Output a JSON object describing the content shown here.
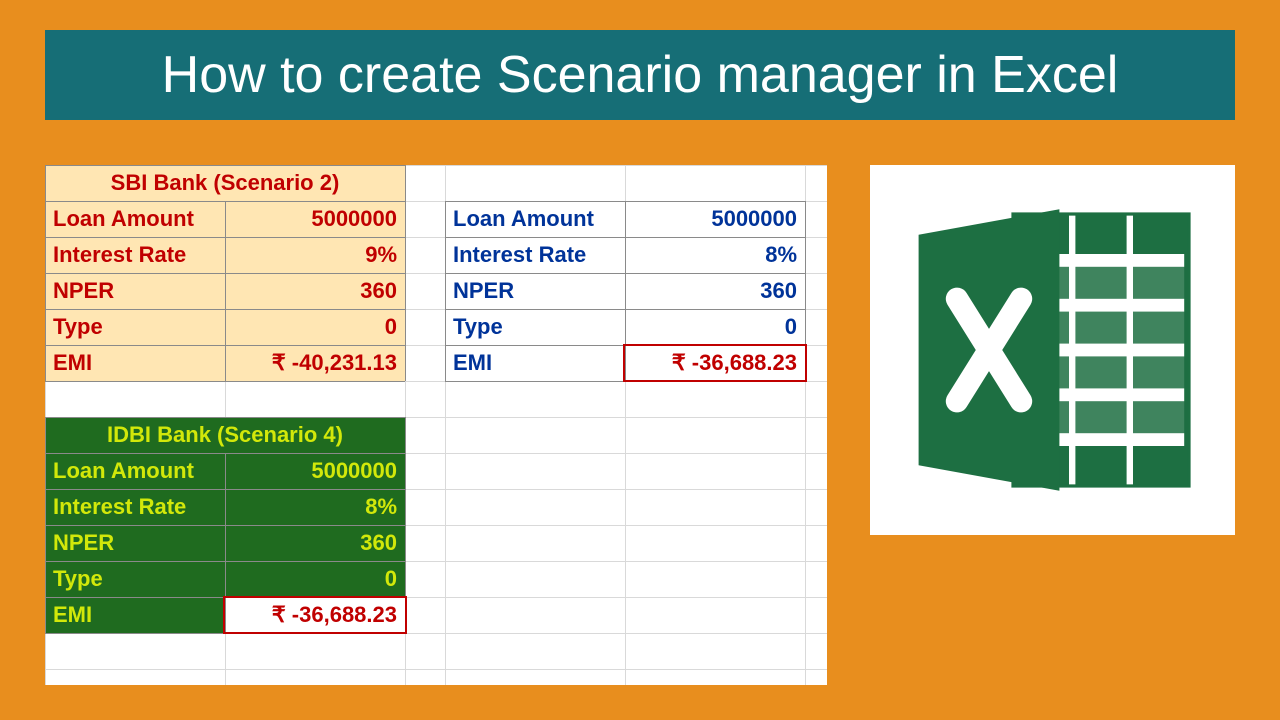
{
  "title": "How to create Scenario manager in Excel",
  "colors": {
    "bg_page": "#e88e1e",
    "banner": "#166e76",
    "sbi_bg": "#ffe6b3",
    "sbi_text": "#c00000",
    "idbi_bg": "#1f6b1f",
    "idbi_text": "#d2e80a",
    "blue_text": "#003399",
    "emi_text": "#c00000",
    "excel_green": "#1d6f42"
  },
  "sbi": {
    "title": "SBI Bank (Scenario 2)",
    "rows": [
      {
        "label": "Loan Amount",
        "value": "5000000"
      },
      {
        "label": "Interest Rate",
        "value": "9%"
      },
      {
        "label": "NPER",
        "value": "360"
      },
      {
        "label": "Type",
        "value": "0"
      },
      {
        "label": "EMI",
        "value": "₹ -40,231.13"
      }
    ]
  },
  "blue": {
    "rows": [
      {
        "label": "Loan Amount",
        "value": "5000000"
      },
      {
        "label": "Interest Rate",
        "value": "8%"
      },
      {
        "label": "NPER",
        "value": "360"
      },
      {
        "label": "Type",
        "value": "0"
      },
      {
        "label": "EMI",
        "value": "₹ -36,688.23"
      }
    ]
  },
  "idbi": {
    "title": "IDBI Bank (Scenario 4)",
    "rows": [
      {
        "label": "Loan Amount",
        "value": "5000000"
      },
      {
        "label": "Interest Rate",
        "value": "8%"
      },
      {
        "label": "NPER",
        "value": "360"
      },
      {
        "label": "Type",
        "value": "0"
      },
      {
        "label": "EMI",
        "value": "₹ -36,688.23"
      }
    ]
  }
}
